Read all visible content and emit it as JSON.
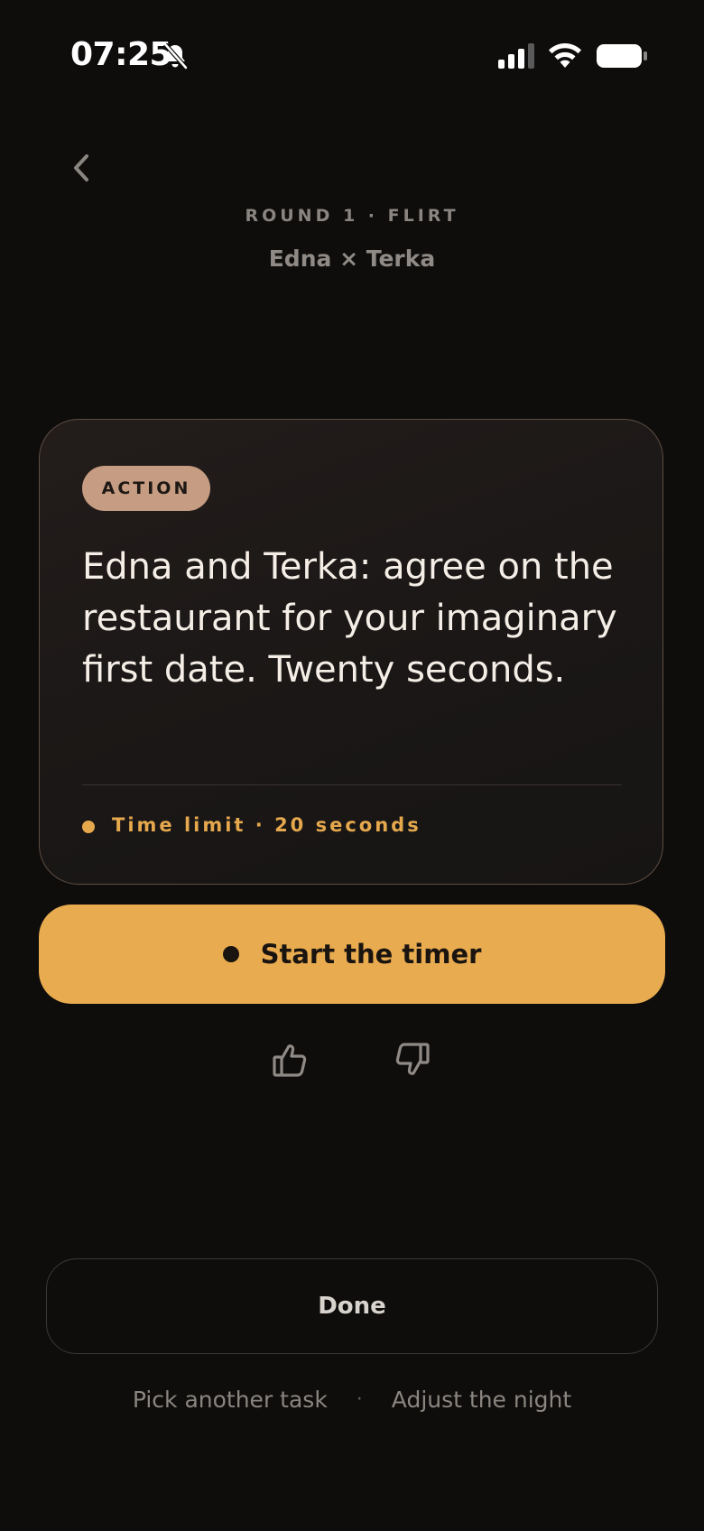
{
  "status_bar": {
    "time": "07:25",
    "icons": [
      "bell-off-icon",
      "cellular-signal-icon",
      "wifi-icon",
      "battery-icon"
    ]
  },
  "header": {
    "back_icon": "chevron-left-icon",
    "round_label": "ROUND 1 · FLIRT",
    "players": "Edna × Terka"
  },
  "card": {
    "badge": "ACTION",
    "text": "Edna and Terka: agree on the restaurant for your imaginary first date. Twenty seconds.",
    "time_limit": "Time limit · 20 seconds"
  },
  "start_button": {
    "label": "Start the timer"
  },
  "feedback": {
    "like_icon": "thumbs-up-icon",
    "dislike_icon": "thumbs-down-icon"
  },
  "done_button": {
    "label": "Done"
  },
  "footer": {
    "pick_another": "Pick another task",
    "separator": "·",
    "adjust": "Adjust the night"
  },
  "colors": {
    "background": "#0e0d0c",
    "accent": "#e8ab4f",
    "badge": "#c69d82",
    "card_border": "#5e4d42"
  }
}
